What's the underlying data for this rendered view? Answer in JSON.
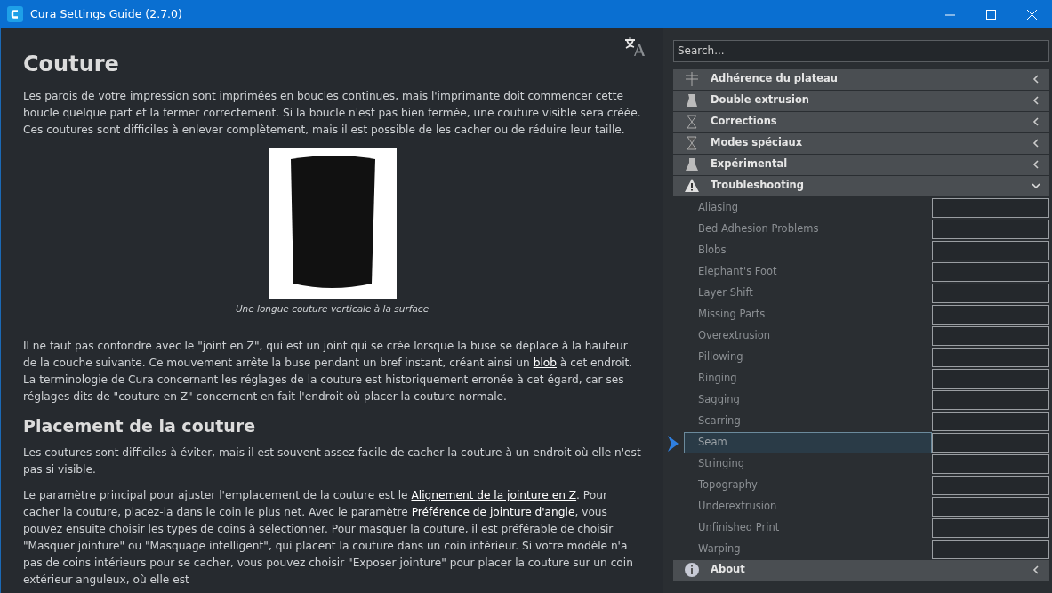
{
  "window": {
    "title": "Cura Settings Guide (2.7.0)"
  },
  "article": {
    "title": "Couture",
    "intro": "Les parois de votre impression sont imprimées en boucles continues, mais l'imprimante doit commencer cette boucle quelque part et la fermer correctement. Si la boucle n'est pas bien fermée, une couture visible sera créée. Ces coutures sont difficiles à enlever complètement, mais il est possible de les cacher ou de réduire leur taille.",
    "figure_caption": "Une longue couture verticale à la surface",
    "paragraph_2": [
      {
        "text": "Il ne faut pas confondre avec le \"joint en Z\", qui est un joint qui se crée lorsque la buse se déplace à la hauteur de la couche suivante. Ce mouvement arrête la buse pendant un bref instant, créant ainsi un "
      },
      {
        "link": "blob"
      },
      {
        "text": " à cet endroit. La terminologie de Cura concernant les réglages de la couture est historiquement erronée à cet égard, car ses réglages dits de \"couture en Z\" concernent en fait l'endroit où placer la couture normale."
      }
    ],
    "heading_2": "Placement de la couture",
    "paragraph_3": [
      {
        "text": "Les coutures sont difficiles à éviter, mais il est souvent assez facile de cacher la couture à un endroit où elle n'est pas si visible."
      }
    ],
    "paragraph_4": [
      {
        "text": "Le paramètre principal pour ajuster l'emplacement de la couture est le "
      },
      {
        "link": "Alignement de la jointure en Z"
      },
      {
        "text": ". Pour cacher la couture, placez-la dans le coin le plus net. Avec le paramètre "
      },
      {
        "link": "Préférence de jointure d'angle"
      },
      {
        "text": ", vous pouvez ensuite choisir les types de coins à sélectionner. Pour masquer la couture, il est préférable de choisir \"Masquer jointure\" ou \"Masquage intelligent\", qui placent la couture dans un coin intérieur. Si votre modèle n'a pas de coins intérieurs pour se cacher, vous pouvez choisir \"Exposer jointure\" pour placer la couture sur un coin extérieur anguleux, où elle est"
      }
    ]
  },
  "sidebar": {
    "search": {
      "placeholder": "Search..."
    },
    "categories": [
      {
        "label": "Adhérence du plateau",
        "expanded": false
      },
      {
        "label": "Double extrusion",
        "expanded": false
      },
      {
        "label": "Corrections",
        "expanded": false
      },
      {
        "label": "Modes spéciaux",
        "expanded": false
      },
      {
        "label": "Expérimental",
        "expanded": false
      },
      {
        "label": "Troubleshooting",
        "expanded": true,
        "items": [
          {
            "label": "Aliasing",
            "selected": false
          },
          {
            "label": "Bed Adhesion Problems",
            "selected": false
          },
          {
            "label": "Blobs",
            "selected": false
          },
          {
            "label": "Elephant's Foot",
            "selected": false
          },
          {
            "label": "Layer Shift",
            "selected": false
          },
          {
            "label": "Missing Parts",
            "selected": false
          },
          {
            "label": "Overextrusion",
            "selected": false
          },
          {
            "label": "Pillowing",
            "selected": false
          },
          {
            "label": "Ringing",
            "selected": false
          },
          {
            "label": "Sagging",
            "selected": false
          },
          {
            "label": "Scarring",
            "selected": false
          },
          {
            "label": "Seam",
            "selected": true
          },
          {
            "label": "Stringing",
            "selected": false
          },
          {
            "label": "Topography",
            "selected": false
          },
          {
            "label": "Underextrusion",
            "selected": false
          },
          {
            "label": "Unfinished Print",
            "selected": false
          },
          {
            "label": "Warping",
            "selected": false
          }
        ]
      },
      {
        "label": "About",
        "expanded": false
      }
    ]
  }
}
